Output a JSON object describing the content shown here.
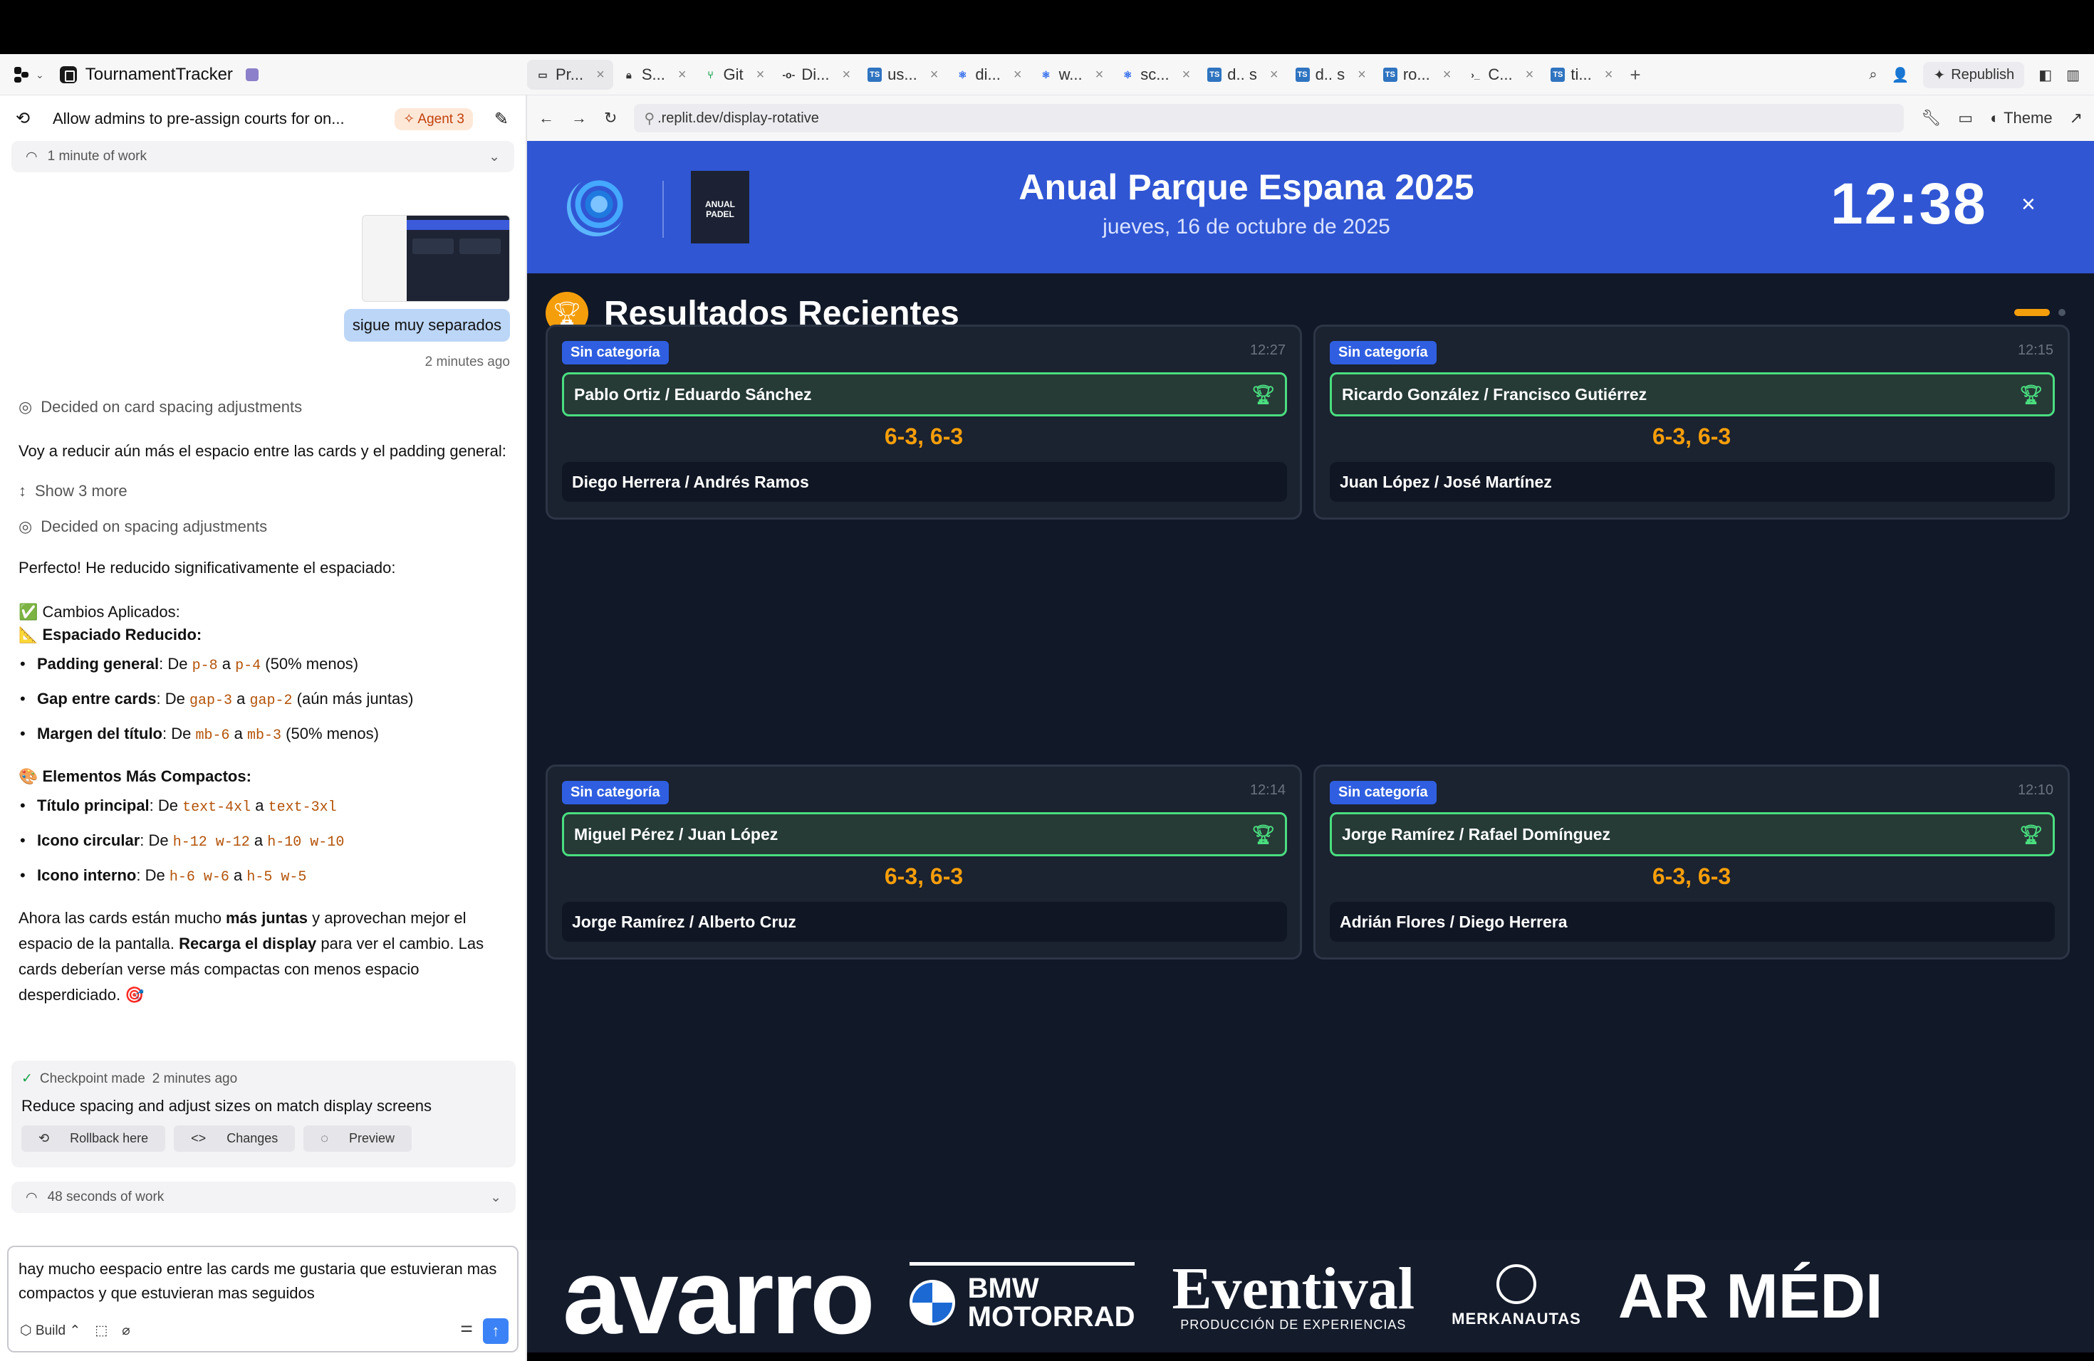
{
  "app": {
    "name": "TournamentTracker"
  },
  "tabs": [
    {
      "label": "Pr...",
      "icon": "preview-icon",
      "active": true
    },
    {
      "label": "S...",
      "icon": "lock-icon"
    },
    {
      "label": "Git",
      "icon": "git-icon"
    },
    {
      "label": "Di...",
      "icon": "commit-icon"
    },
    {
      "label": "us...",
      "icon": "ts-file-icon"
    },
    {
      "label": "di...",
      "icon": "react-icon"
    },
    {
      "label": "w...",
      "icon": "react-icon"
    },
    {
      "label": "sc...",
      "icon": "react-icon"
    },
    {
      "label": "d.. s",
      "icon": "ts-file-icon"
    },
    {
      "label": "d.. s",
      "icon": "ts-file-icon"
    },
    {
      "label": "ro...",
      "icon": "ts-file-icon"
    },
    {
      "label": "C...",
      "icon": "terminal-icon"
    },
    {
      "label": "ti...",
      "icon": "ts-file-icon"
    }
  ],
  "toolbar": {
    "republish": "Republish",
    "theme": "Theme"
  },
  "chat": {
    "thread_title": "Allow admins to pre-assign courts for on...",
    "agent_badge": "Agent 3",
    "work1": "1 minute of work",
    "user_msg": "sigue muy separados",
    "user_time": "2 minutes ago",
    "decided1": "Decided on card spacing adjustments",
    "p1": "Voy a reducir aún más el espacio entre las cards y el padding general:",
    "show_more": "Show 3 more",
    "decided2": "Decided on spacing adjustments",
    "p2": "Perfecto! He reducido significativamente el espaciado:",
    "changes_head": "✅ Cambios Aplicados:",
    "spacing_head": "📐 Espaciado Reducido:",
    "b1_label": "Padding general",
    "b1_a": "p-8",
    "b1_b": "p-4",
    "b1_note": "(50% menos)",
    "b2_label": "Gap entre cards",
    "b2_a": "gap-3",
    "b2_b": "gap-2",
    "b2_note": "(aún más juntas)",
    "b3_label": "Margen del título",
    "b3_a": "mb-6",
    "b3_b": "mb-3",
    "b3_note": "(50% menos)",
    "compact_head": "🎨 Elementos Más Compactos:",
    "c1_label": "Título principal",
    "c1_a": "text-4xl",
    "c1_b": "text-3xl",
    "c2_label": "Icono circular",
    "c2_a": "h-12 w-12",
    "c2_b": "h-10 w-10",
    "c3_label": "Icono interno",
    "c3_a": "h-6 w-6",
    "c3_b": "h-5 w-5",
    "de": "De",
    "a": "a",
    "final_1": "Ahora las cards están mucho ",
    "final_b1": "más juntas",
    "final_2": " y aprovechan mejor el espacio de la pantalla. ",
    "final_b2": "Recarga el display",
    "final_3": " para ver el cambio. Las cards deberían verse más compactas con menos espacio desperdiciado. 🎯",
    "checkpoint": "Checkpoint made",
    "checkpoint_time": "2 minutes ago",
    "checkpoint_desc": "Reduce spacing and adjust sizes on match display screens",
    "rollback": "Rollback here",
    "changes": "Changes",
    "preview": "Preview",
    "work2": "48 seconds of work",
    "input_value": "hay mucho eespacio entre las cards me gustaria que estuvieran mas compactos y que estuvieran mas seguidos",
    "build": "Build"
  },
  "browser": {
    "url": ".replit.dev/display-rotative"
  },
  "display": {
    "title": "Anual Parque Espana 2025",
    "date": "jueves, 16 de octubre de 2025",
    "clock": "12:38",
    "close": "×",
    "badge_text": "ANUAL PADEL",
    "section": "Resultados Recientes",
    "matches": [
      {
        "category": "Sin categoría",
        "time": "12:27",
        "winner": "Pablo Ortiz / Eduardo Sánchez",
        "score": "6-3, 6-3",
        "loser": "Diego Herrera / Andrés Ramos"
      },
      {
        "category": "Sin categoría",
        "time": "12:15",
        "winner": "Ricardo González / Francisco Gutiérrez",
        "score": "6-3, 6-3",
        "loser": "Juan López / José Martínez"
      },
      {
        "category": "Sin categoría",
        "time": "12:14",
        "winner": "Miguel Pérez / Juan López",
        "score": "6-3, 6-3",
        "loser": "Jorge Ramírez / Alberto Cruz"
      },
      {
        "category": "Sin categoría",
        "time": "12:10",
        "winner": "Jorge Ramírez / Rafael Domínguez",
        "score": "6-3, 6-3",
        "loser": "Adrián Flores / Diego Herrera"
      }
    ],
    "sponsors": {
      "avarro": "avarro",
      "bmw1": "BMW",
      "bmw2": "MOTORRAD",
      "eventival": "Eventival",
      "eventival_sub": "PRODUCCIÓN DE EXPERIENCIAS",
      "merkanautas": "MERKANAUTAS",
      "ar": "AR MÉDI"
    }
  }
}
